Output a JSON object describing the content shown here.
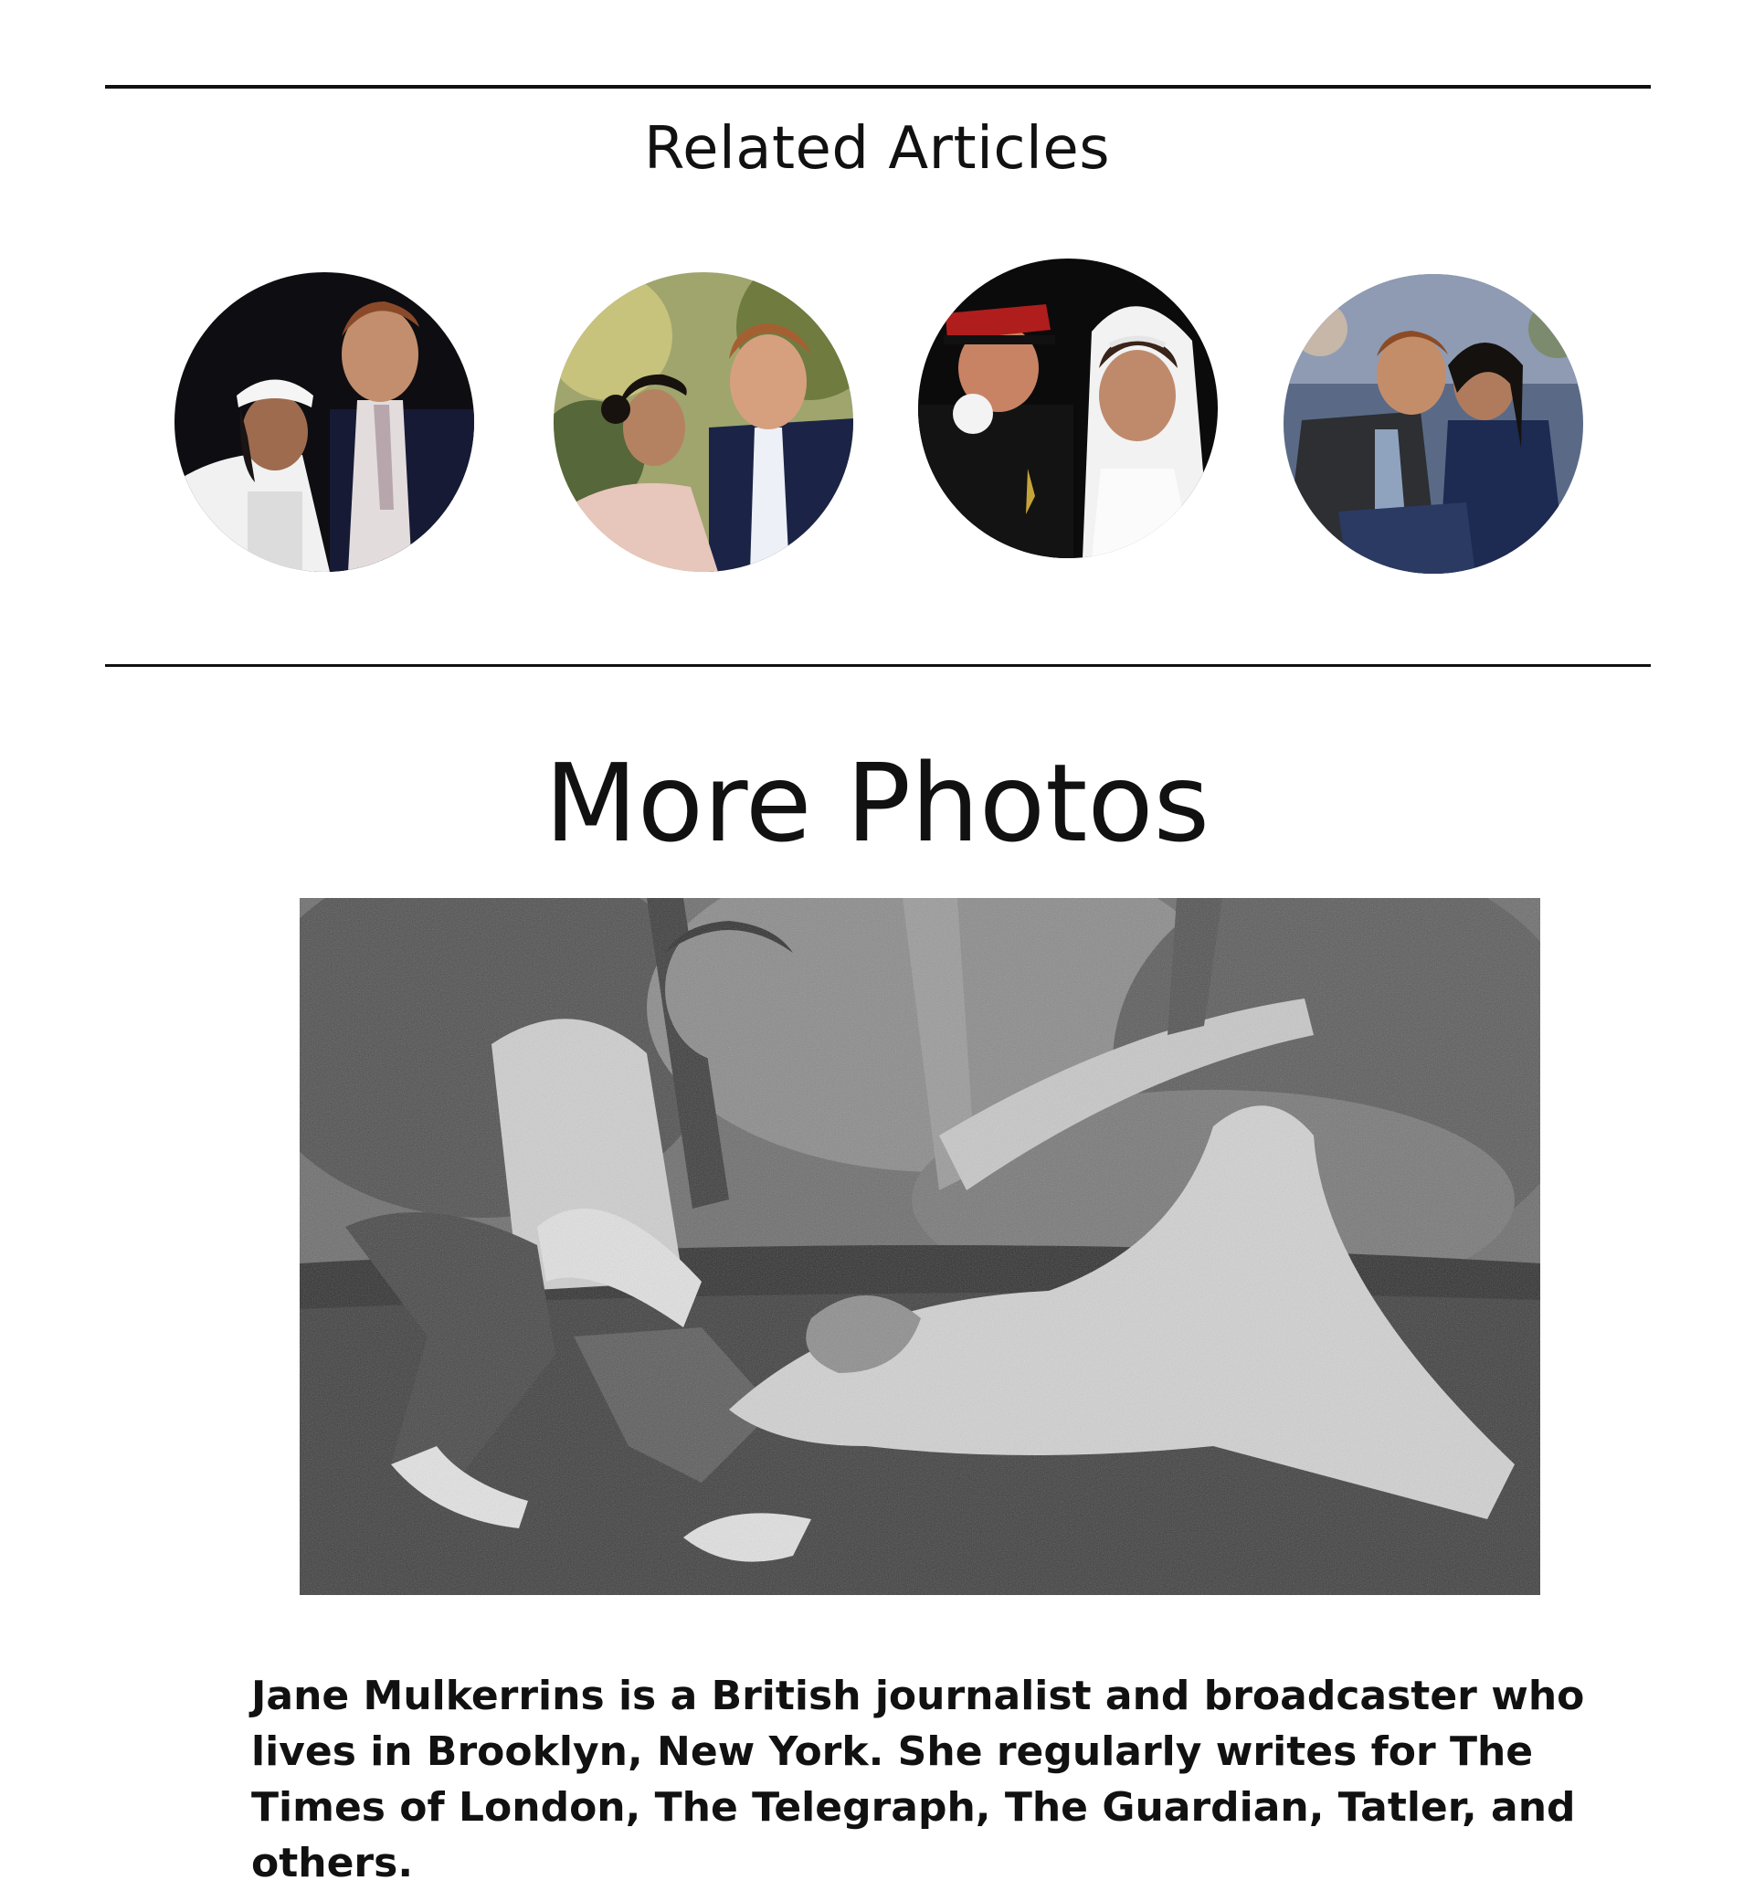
{
  "related": {
    "title": "Related Articles",
    "thumbnails": [
      {
        "icon": "couple-photo-thumbnail"
      },
      {
        "icon": "couple-photo-thumbnail"
      },
      {
        "icon": "wedding-photo-thumbnail"
      },
      {
        "icon": "couple-photo-thumbnail"
      }
    ]
  },
  "more_photos": {
    "title": "More Photos"
  },
  "bio": {
    "text": "Jane Mulkerrins is a British journalist and broadcaster who lives in Brooklyn, New York. She regularly writes for The Times of London, The Telegraph, The Guardian, Tatler, and others."
  }
}
